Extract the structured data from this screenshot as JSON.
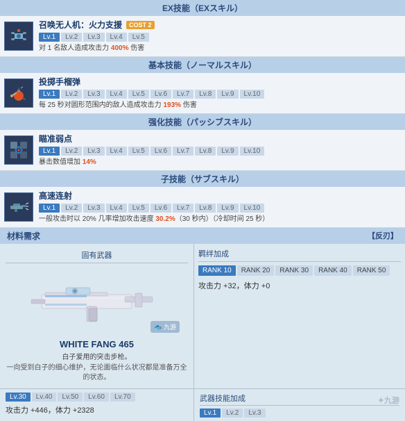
{
  "sections": {
    "ex_skill": {
      "header": "EX技能（EXスキル）",
      "skills": [
        {
          "name": "召唤无人机：火力支援",
          "cost_label": "COST 2",
          "levels": [
            "Lv.1",
            "Lv.2",
            "Lv.3",
            "Lv.4",
            "Lv.5"
          ],
          "active_level": 0,
          "desc": "对 1 名敌人造成攻击力 400% 伤害",
          "highlight": "400%"
        }
      ]
    },
    "normal_skill": {
      "header": "基本技能（ノーマルスキル）",
      "skills": [
        {
          "name": "投掷手榴弹",
          "levels": [
            "Lv.1",
            "Lv.2",
            "Lv.3",
            "Lv.4",
            "Lv.5",
            "Lv.6",
            "Lv.7",
            "Lv.8",
            "Lv.9",
            "Lv.10"
          ],
          "active_level": 0,
          "desc": "每 25 秒对圆形范围内的敌人造成攻击力 193% 伤害",
          "highlight": "193%"
        }
      ]
    },
    "passive_skill": {
      "header": "强化技能（パッシブスキル）",
      "skills": [
        {
          "name": "瞄准弱点",
          "levels": [
            "Lv.1",
            "Lv.2",
            "Lv.3",
            "Lv.4",
            "Lv.5",
            "Lv.6",
            "Lv.7",
            "Lv.8",
            "Lv.9",
            "Lv.10"
          ],
          "active_level": 0,
          "desc": "暴击数值增加 14%",
          "highlight": "14%"
        }
      ]
    },
    "sub_skill": {
      "header": "子技能（サブスキル）",
      "skills": [
        {
          "name": "高速连射",
          "levels": [
            "Lv.1",
            "Lv.2",
            "Lv.3",
            "Lv.4",
            "Lv.5",
            "Lv.6",
            "Lv.7",
            "Lv.8",
            "Lv.9",
            "Lv.10"
          ],
          "active_level": 0,
          "desc": "一般攻击时以 20% 几率增加攻击速度 30.2%（30 秒内）（冷却时间 25 秒）",
          "highlight": "30.2%"
        }
      ]
    }
  },
  "materials": {
    "header": "材料需求",
    "revert_label": "【反刃】",
    "weapon_panel": {
      "title": "固有武器",
      "weapon_name": "WHITE FANG 465",
      "weapon_subdesc": "白子爱用的突击步枪。",
      "weapon_lore": "一向受到白子的细心维护，无论面临什么状况都是准备万全的状态。"
    },
    "bonus_panel": {
      "title": "羁绊加成",
      "ranks": [
        "RANK 10",
        "RANK 20",
        "RANK 30",
        "RANK 40",
        "RANK 50"
      ],
      "active_rank": 0,
      "stats": "攻击力 +32，体力 +0"
    },
    "level_section": {
      "levels": [
        "Lv.30",
        "Lv.40",
        "Lv.50",
        "Lv.60",
        "Lv.70"
      ],
      "active_level": 0,
      "stats": "攻击力 +446，体力 +2328"
    },
    "weapon_skill": {
      "title": "武器技能加成",
      "levels": [
        "Lv.1",
        "Lv.2",
        "Lv.3"
      ],
      "active_level": 0
    }
  },
  "watermark": "九游",
  "colors": {
    "active_btn": "#3a7abf",
    "inactive_btn": "#c8d8e8",
    "header_bg": "#b8cfe8",
    "highlight": "#e05020",
    "rank_active": "#3a7abf"
  }
}
